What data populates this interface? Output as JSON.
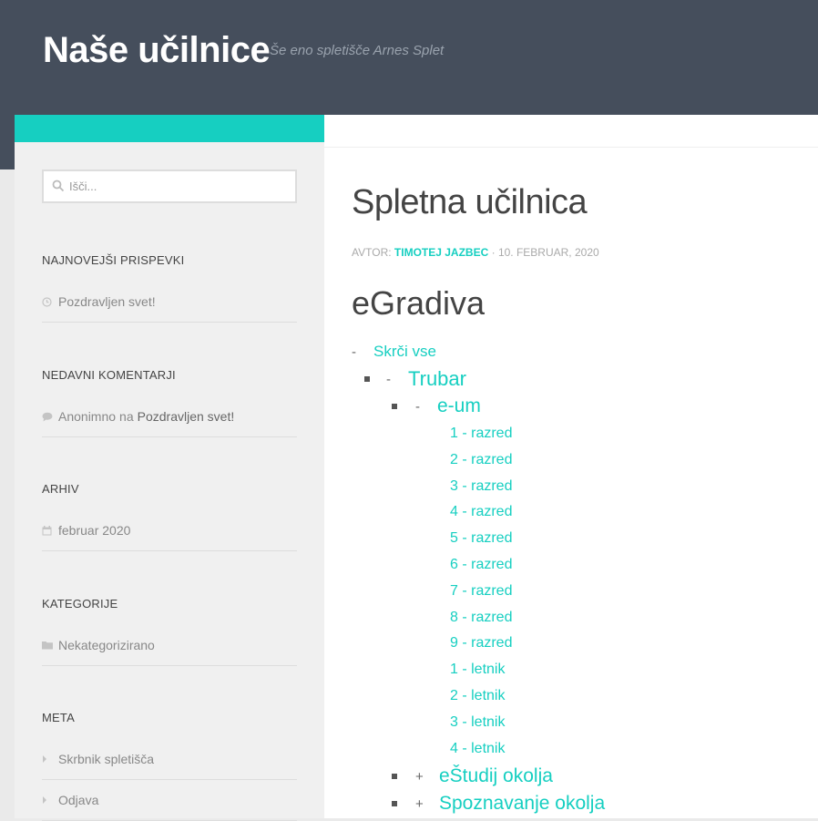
{
  "header": {
    "site_title": "Naše učilnice",
    "tagline": "Še eno spletišče Arnes Splet"
  },
  "search": {
    "placeholder": "Išči..."
  },
  "sidebar": {
    "recent_posts": {
      "title": "NAJNOVEJŠI PRISPEVKI",
      "items": [
        "Pozdravljen svet!"
      ]
    },
    "recent_comments": {
      "title": "NEDAVNI KOMENTARJI",
      "author": "Anonimno",
      "on": "na",
      "post": "Pozdravljen svet!"
    },
    "archive": {
      "title": "ARHIV",
      "items": [
        "februar 2020"
      ]
    },
    "categories": {
      "title": "KATEGORIJE",
      "items": [
        "Nekategorizirano"
      ]
    },
    "meta": {
      "title": "META",
      "items": [
        "Skrbnik spletišča",
        "Odjava"
      ]
    }
  },
  "post": {
    "title": "Spletna učilnica",
    "byline_prefix": "AVTOR:",
    "author": "TIMOTEJ JAZBEC",
    "separator": "·",
    "date": "10. FEBRUAR, 2020",
    "section_heading": "eGradiva"
  },
  "tree": {
    "collapse_all": {
      "toggle": "-",
      "label": "Skrči vse"
    },
    "trubar": {
      "toggle": "-",
      "label": "Trubar"
    },
    "eum": {
      "toggle": "-",
      "label": "e-um"
    },
    "eum_items": [
      "1 - razred",
      "2 - razred",
      "3 - razred",
      "4 - razred",
      "5 - razred",
      "6 - razred",
      "7 - razred",
      "8 - razred",
      "9 - razred",
      "1 - letnik",
      "2 - letnik",
      "3 - letnik",
      "4 - letnik"
    ],
    "estudij": {
      "toggle": "+",
      "label": "eŠtudij okolja"
    },
    "spoznavanje": {
      "toggle": "+",
      "label": "Spoznavanje okolja"
    }
  },
  "colors": {
    "accent": "#16cfc1",
    "header_bg": "#454e5c"
  }
}
